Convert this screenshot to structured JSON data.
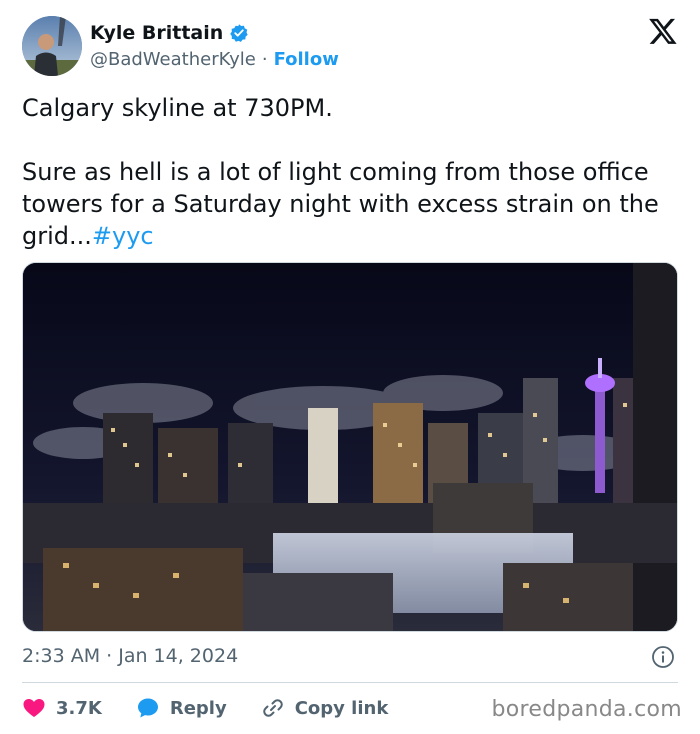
{
  "author": {
    "name": "Kyle Brittain",
    "handle": "@BadWeatherKyle",
    "separator": "·",
    "follow_label": "Follow"
  },
  "tweet": {
    "text": "Calgary skyline at 730PM.\n\nSure as hell is a lot of light coming from those office towers for a Saturday night with excess strain on the grid...",
    "hashtag": "#yyc",
    "timestamp": "2:33 AM · Jan 14, 2024"
  },
  "actions": {
    "like_count": "3.7K",
    "reply_label": "Reply",
    "copy_link_label": "Copy link"
  },
  "watermark": "boredpanda.com",
  "colors": {
    "accent": "#1d9bf0",
    "like": "#f91880",
    "text": "#0f1419",
    "muted": "#536471"
  },
  "icons": {
    "logo": "x-logo-icon",
    "verified": "verified-badge-icon",
    "info": "info-icon",
    "like": "heart-icon",
    "reply": "speech-bubble-icon",
    "copy_link": "link-icon"
  }
}
